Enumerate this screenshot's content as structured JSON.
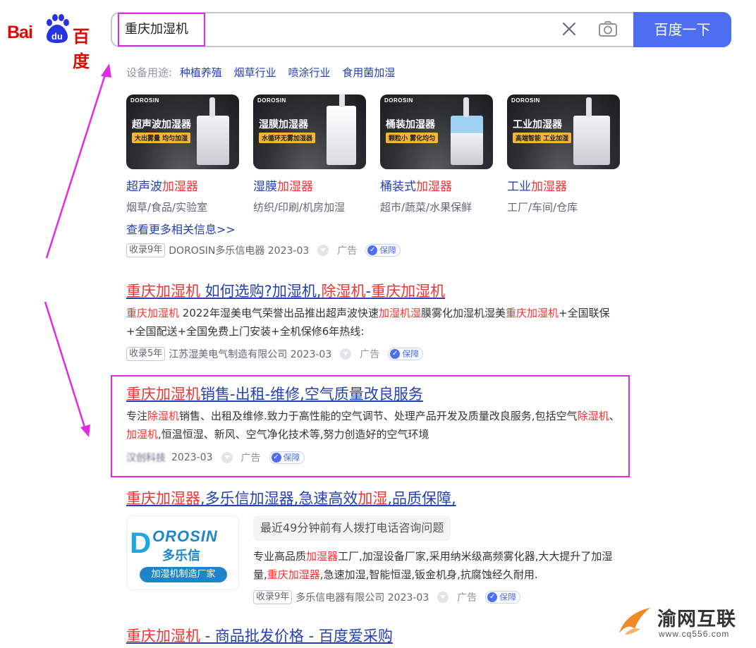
{
  "logo": {
    "text_latin": "Bai",
    "text_du": "du",
    "text_cn": "百度"
  },
  "search": {
    "query": "重庆加湿机",
    "button_label": "百度一下"
  },
  "ad_block": {
    "usage_label": "设备用途:",
    "usage_tags": [
      "种植养殖",
      "烟草行业",
      "喷涂行业",
      "食用菌加湿"
    ],
    "products": [
      {
        "brand": "DOROSIN",
        "image_title": "超声波加湿器",
        "image_slogan": "大出雾量 均匀加湿",
        "title_prefix": "超声波",
        "title_hl": "加湿器",
        "subtitle": "烟草/食品/实验室"
      },
      {
        "brand": "DOROSIN",
        "image_title": "湿膜加湿器",
        "image_slogan": "水循环无雾加湿器",
        "title_prefix": "湿膜",
        "title_hl": "加湿器",
        "subtitle": "纺织/印刷/机房加湿"
      },
      {
        "brand": "DOROSIN",
        "image_title": "桶装加湿器",
        "image_slogan": "颗粒小 雾化均匀",
        "title_prefix": "桶装式",
        "title_hl": "加湿器",
        "subtitle": "超市/蔬菜/水果保鲜"
      },
      {
        "brand": "DOROSIN",
        "image_title": "工业加湿器",
        "image_slogan": "高端智能 工业加湿",
        "title_prefix": "工业",
        "title_hl": "加湿器",
        "subtitle": "工厂/车间/仓库"
      }
    ],
    "more_link": "查看更多相关信息>>",
    "meta": {
      "badge": "收录9年",
      "source": "DOROSIN多乐信电器 2023-03",
      "ad": "广告",
      "guarantee": "保障"
    }
  },
  "results": [
    {
      "title": {
        "p1": "重庆加湿机",
        "p2": " 如何选购?加湿机,",
        "p3": "除湿机",
        "p4": "-",
        "p5": "重庆加湿机"
      },
      "desc": {
        "s1": "重庆加湿机",
        "s2": " 2022年湿美电气荣誉出品推出超声波快速",
        "s3": "加湿机湿",
        "s4": "膜雾化加湿机湿美",
        "s5": "重庆加湿机",
        "s6": "+全国联保+全国配送+全国免费上门安装+全机保修6年热线:"
      },
      "meta": {
        "badge": "收录5年",
        "source": "江苏湿美电气制造有限公司 2023-03",
        "ad": "广告",
        "guarantee": "保障"
      }
    },
    {
      "title": {
        "p1": "重庆加湿机",
        "p2": "销售-出租-维修,空气质量改良服务"
      },
      "desc": {
        "s1": "专注",
        "s2": "除湿机",
        "s3": "销售、出租及维修.致力于高性能的空气调节、处理产品开发及质量改良服务,包括空气",
        "s4": "除湿机",
        "s5": "、",
        "s6": "加湿机",
        "s7": ",恒温恒湿、新风、空气净化技术等,努力创造好的空气环境"
      },
      "meta": {
        "source": "汉创科技",
        "date": "2023-03",
        "ad": "广告",
        "guarantee": "保障"
      }
    },
    {
      "title": {
        "p1": "重庆加湿器",
        "p2": ",多乐信加湿器,急速高效",
        "p3": "加湿",
        "p4": ",品质保障,"
      },
      "logo": {
        "mark": "D",
        "name": "OROSIN",
        "cn": "多乐信",
        "strip": "加湿机制造厂家"
      },
      "callout": "最近49分钟前有人拨打电话咨询问题",
      "desc": {
        "s1": "专业高品质",
        "s2": "加湿器",
        "s3": "工厂,加湿设备厂家,采用纳米级高频雾化器,大大提升了加湿量,",
        "s4": "重庆加湿器",
        "s5": ",急速加湿,智能恒湿,钣金机身,抗腐蚀经久耐用."
      },
      "meta": {
        "badge": "收录9年",
        "source": "多乐信电器有限公司 2023-03",
        "ad": "广告",
        "guarantee": "保障"
      }
    },
    {
      "title": {
        "p1": "重庆加湿机",
        "p2": " - 商品批发价格 - 百度爱采购"
      }
    }
  ],
  "watermark": {
    "name": "渝网互联",
    "url": "www.cq556.com"
  },
  "colors": {
    "accent": "#4e6ef2",
    "link": "#2440b3",
    "highlight": "#f73131",
    "annotation": "#e12be1"
  }
}
